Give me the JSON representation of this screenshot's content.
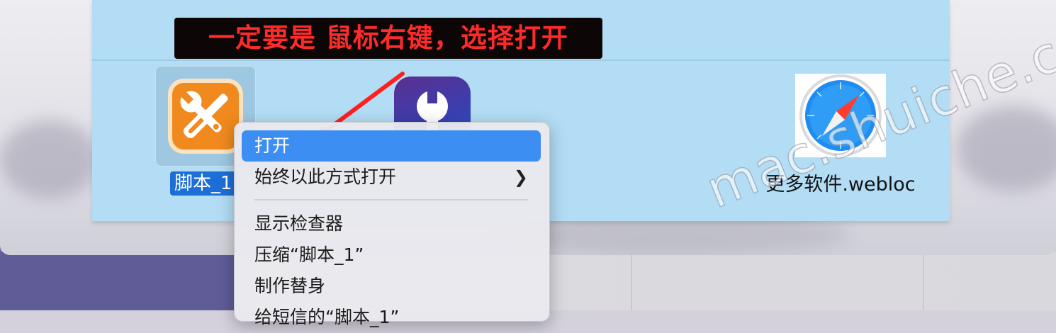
{
  "annotation": {
    "text": "一定要是 鼠标右键，选择打开"
  },
  "files": [
    {
      "label": "脚本_1",
      "icon": "tools-app-icon",
      "selected": true
    },
    {
      "label": "",
      "icon": "wrench-app-icon",
      "selected": false
    },
    {
      "label": "更多软件.webloc",
      "icon": "safari-icon",
      "selected": false
    }
  ],
  "context_menu": {
    "items": [
      {
        "label": "打开",
        "highlighted": true
      },
      {
        "label": "始终以此方式打开",
        "submenu_icon": "chevron-right-icon"
      },
      {
        "label": "显示检查器"
      },
      {
        "label": "压缩“脚本_1”"
      },
      {
        "label": "制作替身"
      },
      {
        "label": "给短信的“脚本_1”"
      }
    ]
  },
  "watermark": {
    "text": "mac.shuiche.cc"
  },
  "colors": {
    "annotation_text": "#ff2a2a",
    "annotation_bg": "#0d0606",
    "menu_highlight": "#3d8ef2",
    "panel_bg": "#b3ddf5",
    "selection_label": "#1d6fd8"
  }
}
